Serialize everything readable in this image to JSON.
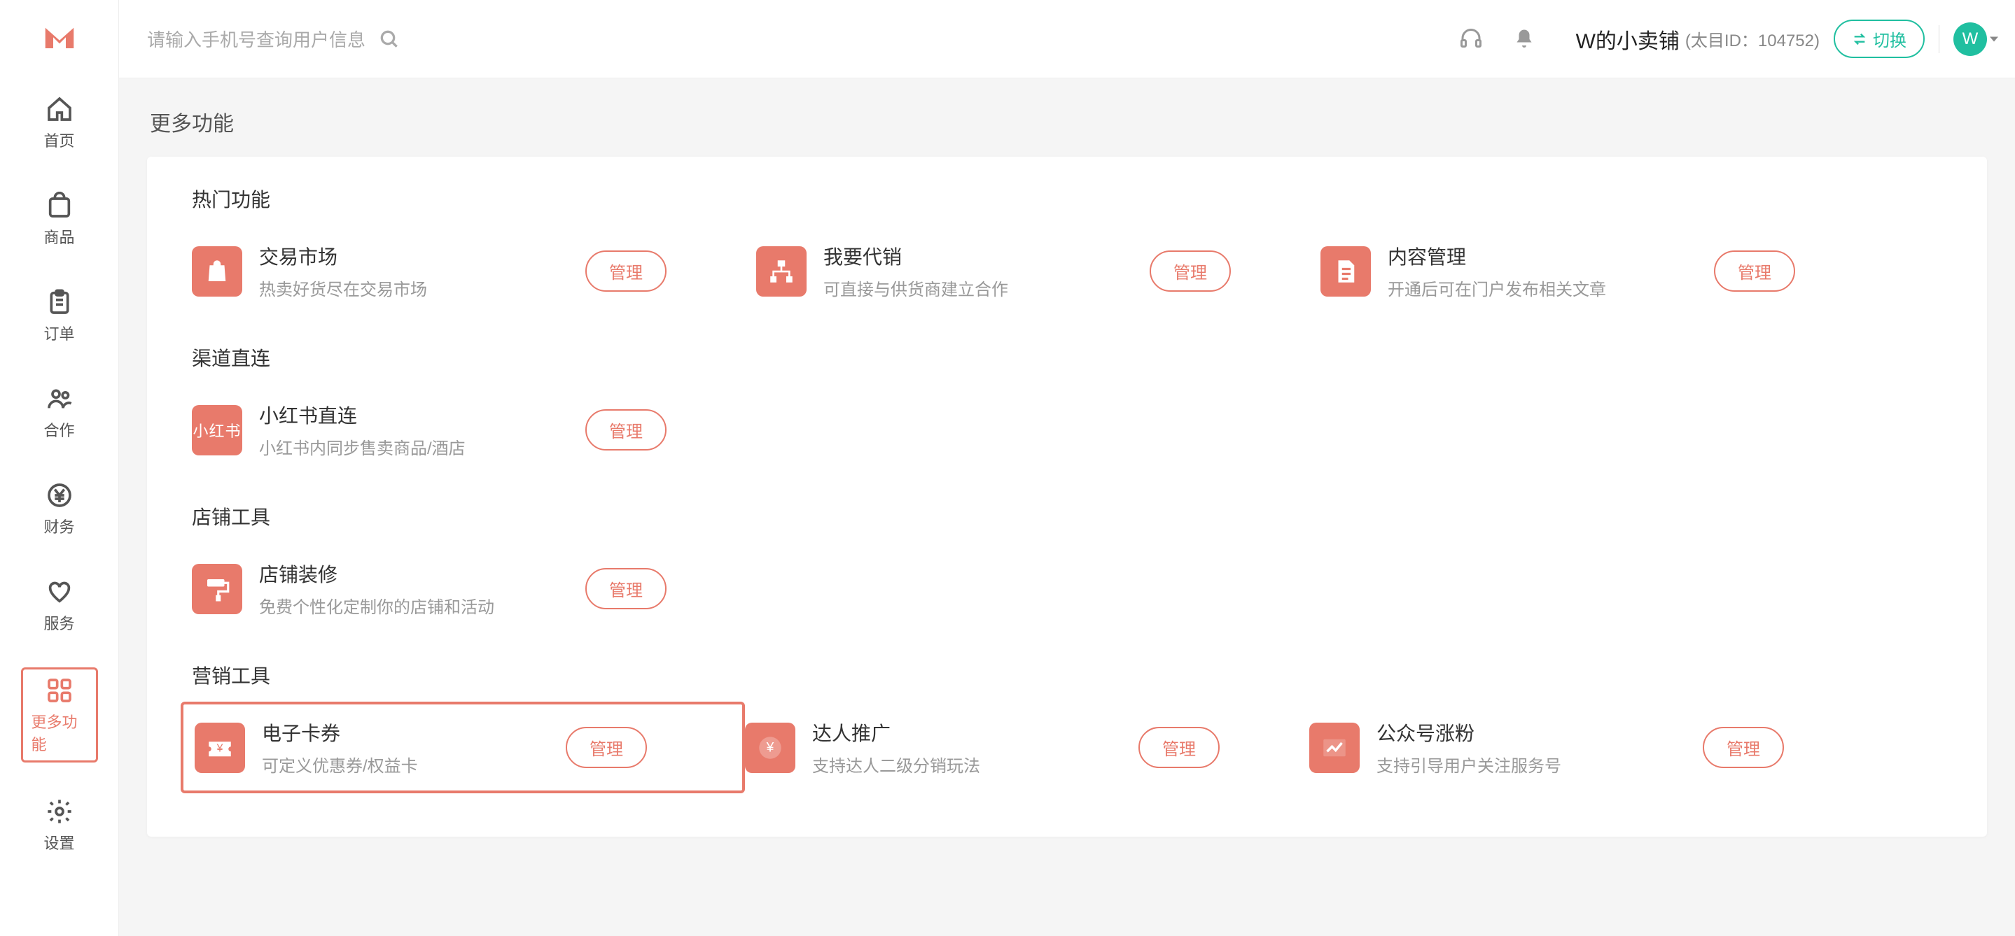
{
  "header": {
    "search_placeholder": "请输入手机号查询用户信息",
    "shop_name": "W的小卖铺",
    "shop_id_label": "(太目ID：104752)",
    "switch_label": "切换",
    "avatar_letter": "W"
  },
  "sidebar": {
    "items": [
      {
        "key": "home",
        "label": "首页"
      },
      {
        "key": "goods",
        "label": "商品"
      },
      {
        "key": "orders",
        "label": "订单"
      },
      {
        "key": "partner",
        "label": "合作"
      },
      {
        "key": "finance",
        "label": "财务"
      },
      {
        "key": "service",
        "label": "服务"
      },
      {
        "key": "more",
        "label": "更多功能"
      },
      {
        "key": "settings",
        "label": "设置"
      }
    ]
  },
  "page": {
    "title": "更多功能",
    "manage_label": "管理",
    "sections": [
      {
        "title": "热门功能",
        "cards": [
          {
            "title": "交易市场",
            "desc": "热卖好货尽在交易市场"
          },
          {
            "title": "我要代销",
            "desc": "可直接与供货商建立合作"
          },
          {
            "title": "内容管理",
            "desc": "开通后可在门户发布相关文章"
          }
        ]
      },
      {
        "title": "渠道直连",
        "cards": [
          {
            "title": "小红书直连",
            "desc": "小红书内同步售卖商品/酒店",
            "icon_text": "小红书"
          }
        ]
      },
      {
        "title": "店铺工具",
        "cards": [
          {
            "title": "店铺装修",
            "desc": "免费个性化定制你的店铺和活动"
          }
        ]
      },
      {
        "title": "营销工具",
        "cards": [
          {
            "title": "电子卡券",
            "desc": "可定义优惠券/权益卡",
            "highlighted": true
          },
          {
            "title": "达人推广",
            "desc": "支持达人二级分销玩法"
          },
          {
            "title": "公众号涨粉",
            "desc": "支持引导用户关注服务号"
          }
        ]
      }
    ]
  }
}
